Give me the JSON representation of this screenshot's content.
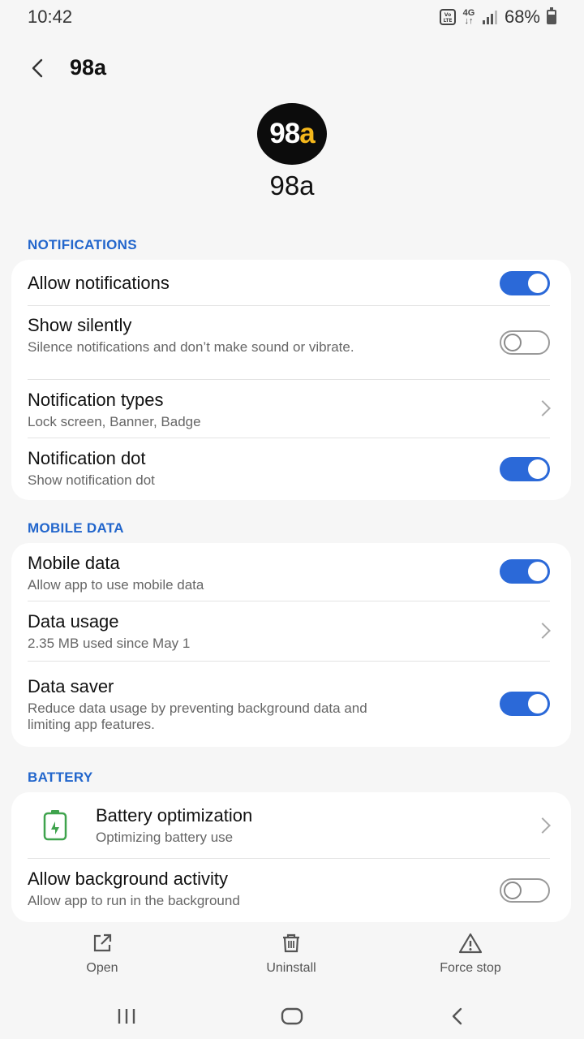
{
  "status_bar": {
    "time": "10:42",
    "battery_percent": "68%",
    "volte_label": "VoLTE",
    "network_label": "4G"
  },
  "header": {
    "title": "98a"
  },
  "app": {
    "logo_main": "98",
    "logo_accent": "a",
    "name": "98a"
  },
  "sections": {
    "notifications": {
      "label": "NOTIFICATIONS",
      "allow_notifications": {
        "title": "Allow notifications",
        "enabled": true
      },
      "show_silently": {
        "title": "Show silently",
        "subtitle": "Silence notifications and don’t make sound or vibrate.",
        "enabled": false
      },
      "notification_types": {
        "title": "Notification types",
        "subtitle": "Lock screen, Banner, Badge"
      },
      "notification_dot": {
        "title": "Notification dot",
        "subtitle": "Show notification dot",
        "enabled": true
      }
    },
    "mobile_data": {
      "label": "MOBILE DATA",
      "mobile_data": {
        "title": "Mobile data",
        "subtitle": "Allow app to use mobile data",
        "enabled": true
      },
      "data_usage": {
        "title": "Data usage",
        "subtitle": "2.35 MB used since May 1"
      },
      "data_saver": {
        "title": "Data saver",
        "subtitle": "Reduce data usage by preventing background data and limiting app features.",
        "enabled": true
      }
    },
    "battery": {
      "label": "BATTERY",
      "battery_optimization": {
        "title": "Battery optimization",
        "subtitle": "Optimizing battery use"
      },
      "background_activity": {
        "title": "Allow background activity",
        "subtitle": "Allow app to run in the background",
        "enabled": false
      }
    }
  },
  "actions": {
    "open": "Open",
    "uninstall": "Uninstall",
    "force_stop": "Force stop"
  },
  "colors": {
    "accent": "#2b69d8",
    "section_label": "#2266cc",
    "logo_accent": "#f4b71b",
    "battery_icon": "#3fa34d"
  }
}
